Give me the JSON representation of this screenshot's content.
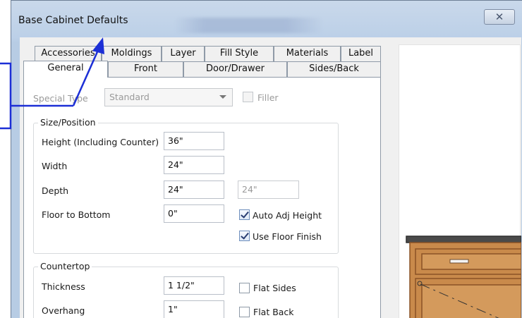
{
  "window": {
    "title": "Base Cabinet Defaults",
    "close_glyph": "✕"
  },
  "tabs_row1": [
    "Accessories",
    "Moldings",
    "Layer",
    "Fill Style",
    "Materials",
    "Label"
  ],
  "tabs_row2": [
    "General",
    "Front",
    "Door/Drawer",
    "Sides/Back"
  ],
  "active_tab": "General",
  "general": {
    "special_type": {
      "label": "Special Type",
      "value": "Standard"
    },
    "filler": {
      "label": "Filler",
      "checked": false,
      "enabled": false
    }
  },
  "size_position": {
    "legend": "Size/Position",
    "height": {
      "label": "Height (Including Counter)",
      "value": "36\""
    },
    "width": {
      "label": "Width",
      "value": "24\""
    },
    "depth": {
      "label": "Depth",
      "value": "24\"",
      "secondary_value": "24\""
    },
    "floor_to_bottom": {
      "label": "Floor to Bottom",
      "value": "0\""
    },
    "auto_adj_height": {
      "label": "Auto Adj Height",
      "checked": true
    },
    "use_floor_finish": {
      "label": "Use Floor Finish",
      "checked": true
    }
  },
  "countertop": {
    "legend": "Countertop",
    "thickness": {
      "label": "Thickness",
      "value": "1 1/2\""
    },
    "overhang": {
      "label": "Overhang",
      "value": "1\""
    },
    "flat_sides": {
      "label": "Flat Sides",
      "checked": false
    },
    "flat_back": {
      "label": "Flat Back",
      "checked": false
    }
  },
  "colors": {
    "cabinet_wood": "#c98a4b",
    "cabinet_wood_dark": "#8a5326",
    "countertop": "#4a4a4a",
    "annotation": "#1c2fd6"
  }
}
